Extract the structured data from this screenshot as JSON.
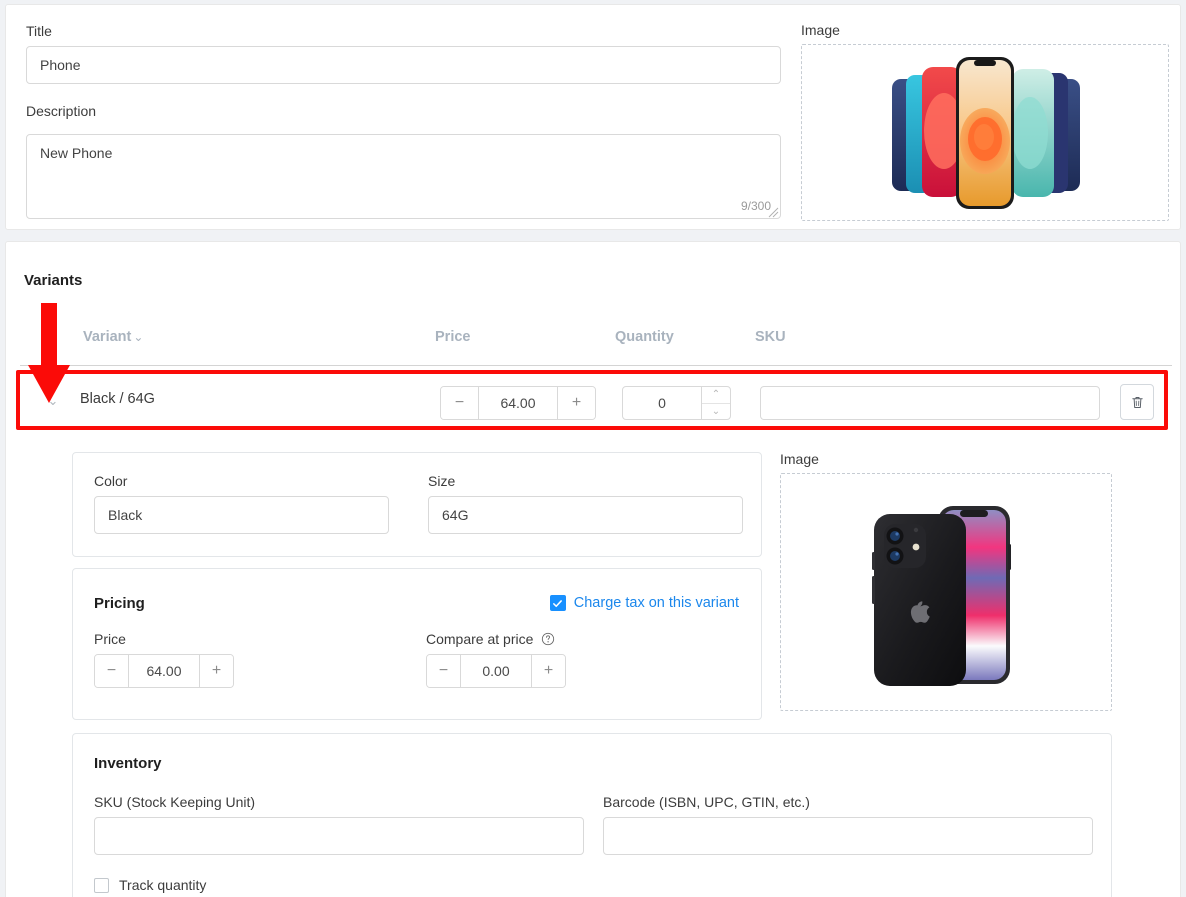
{
  "general": {
    "title_label": "Title",
    "title_value": "Phone",
    "title_placeholder": "Title",
    "description_label": "Description",
    "description_value": "New Phone",
    "description_placeholder": "Description",
    "description_counter": "9/300",
    "image_label": "Image"
  },
  "variants": {
    "section_title": "Variants",
    "columns": {
      "variant": "Variant",
      "price": "Price",
      "quantity": "Quantity",
      "sku": "SKU"
    },
    "sort_chevron": "⌄",
    "row": {
      "expand_chevron": "⌄",
      "name": "Black / 64G",
      "price": "64.00",
      "quantity": "0",
      "sku": "",
      "sku_placeholder": "",
      "minus": "−",
      "plus": "+",
      "spin_up": "⌃",
      "spin_down": "⌄"
    }
  },
  "options": {
    "color_label": "Color",
    "color_value": "Black",
    "color_placeholder": "Color",
    "size_label": "Size",
    "size_value": "64G",
    "size_placeholder": "Size"
  },
  "pricing": {
    "title": "Pricing",
    "charge_tax_label": "Charge tax on this variant",
    "charge_tax_checked": true,
    "price_label": "Price",
    "price_value": "64.00",
    "compare_label": "Compare at price",
    "compare_value": "0.00",
    "minus": "−",
    "plus": "+"
  },
  "inventory": {
    "title": "Inventory",
    "sku_label": "SKU (Stock Keeping Unit)",
    "sku_value": "",
    "sku_placeholder": "",
    "barcode_label": "Barcode (ISBN, UPC, GTIN, etc.)",
    "barcode_value": "",
    "barcode_placeholder": "",
    "track_quantity_label": "Track quantity",
    "track_quantity_checked": false
  },
  "variant_image": {
    "label": "Image"
  },
  "colors": {
    "accent_blue": "#1890ff",
    "link_blue": "#1b87ec",
    "annotation_red": "#fb0b08",
    "header_gray": "#a9b3be",
    "border_gray": "#d9d9d9",
    "page_bg": "#f0f2f5"
  }
}
